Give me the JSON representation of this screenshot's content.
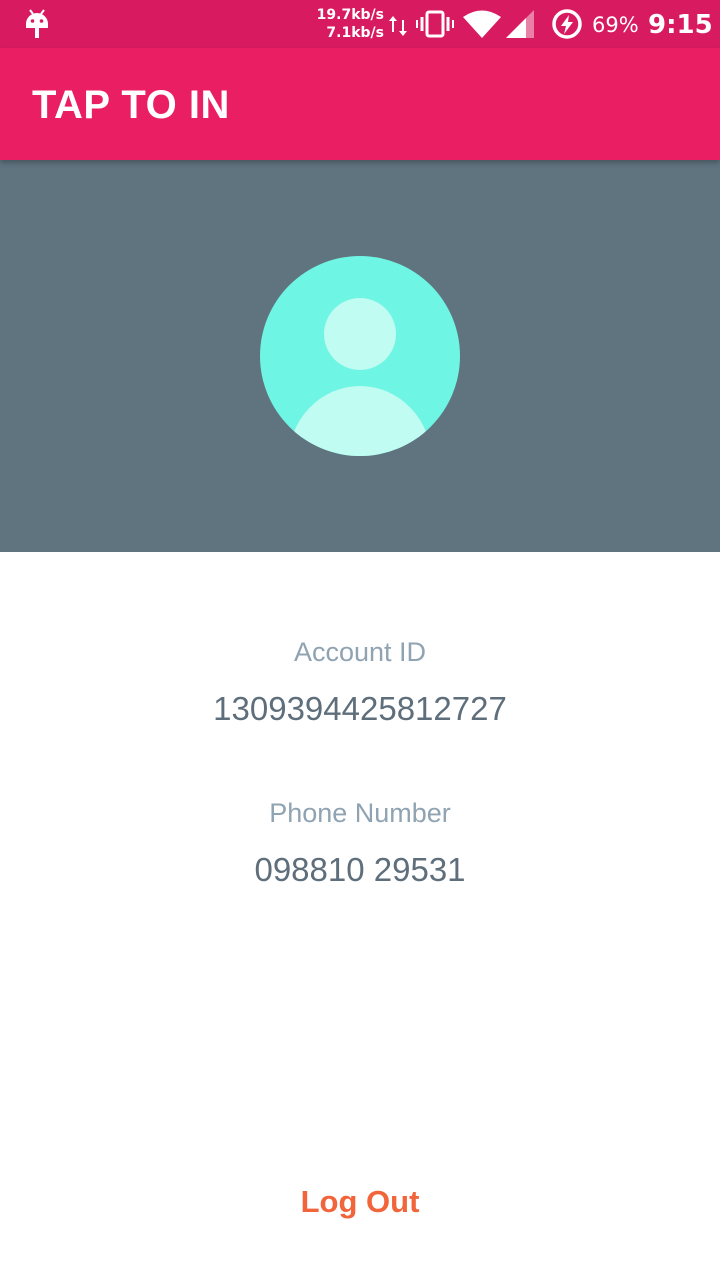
{
  "status_bar": {
    "net_speed_up": "19.7kb/s",
    "net_speed_down": "7.1kb/s",
    "battery_percent": "69%",
    "time": "9:15",
    "icons": [
      "android-icon",
      "data-arrows-icon",
      "vibrate-icon",
      "wifi-icon",
      "signal-icon",
      "battery-saver-icon"
    ],
    "color": "#d81b60"
  },
  "app_bar": {
    "title": "TAP TO IN",
    "color": "#e91e63"
  },
  "profile": {
    "header_color": "#607480",
    "avatar_icon": "default-user-avatar-icon",
    "avatar_color": "#6ff5e3"
  },
  "info": {
    "account_id_label": "Account ID",
    "account_id_value": "1309394425812727",
    "phone_label": "Phone Number",
    "phone_value": "098810 29531"
  },
  "actions": {
    "logout_label": "Log Out",
    "logout_color": "#f26439"
  }
}
